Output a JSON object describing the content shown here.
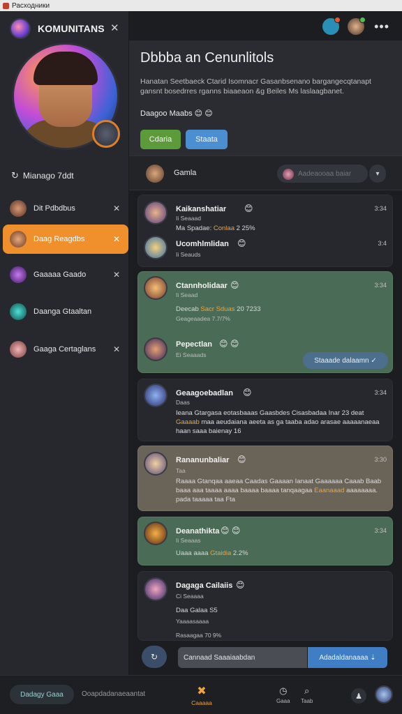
{
  "window": {
    "title": "Расходники"
  },
  "sidebar": {
    "title": "KOMUNITANS",
    "section_label": "Mianago 7ddt",
    "items": [
      {
        "label": "Dit Pdbdbus",
        "avatar_color": "#7a4a3a",
        "active": false
      },
      {
        "label": "Daag Reagdbs",
        "avatar_color": "#8a5a3c",
        "active": true
      },
      {
        "label": "Gaaaaa Gaado",
        "avatar_color": "#8b3bd0",
        "active": false
      },
      {
        "label": "Daanga Gtaaltan",
        "avatar_color": "#1aa8a0",
        "active": false
      },
      {
        "label": "Gaaga Certaglans",
        "avatar_color": "#d08a8a",
        "active": false
      }
    ]
  },
  "main": {
    "title": "Dbbba an Cenunlitols",
    "description": "Hanatan Seetbaeck Ctarid Isomnacr Gasanbsenano bargangecqtanapt gansnt bosedrres rganns biaaeaon &g Beiles Ms laslaagbanet.",
    "status": "Daagoo Maabs",
    "buttons": {
      "primary": "Cdaria",
      "secondary": "Staata"
    }
  },
  "channel": {
    "name": "Gamla",
    "search_placeholder": "Aadeaooaa baiar"
  },
  "messages": [
    {
      "name": "Kaikanshatiar",
      "time": "3:34",
      "sub": "Ii Seaaad",
      "line_pre": "Ma Spadae:",
      "line_hl": "Conlaa",
      "line_post": "2 25%"
    },
    {
      "name": "Ucomhlmlidan",
      "time": "3:4",
      "sub": "Ii Seauds"
    },
    {
      "name": "Ctannholidaar",
      "time": "3:34",
      "sub": "Ii Seaad",
      "line_pre": "Deecab",
      "line_hl": "Sacr Sduas",
      "line_post": "20 7233",
      "extra": "Geageaadea 7.7/7%"
    },
    {
      "name": "Pepectlan",
      "time": "",
      "sub": "Ei Seaaads",
      "action": "Staaade dalaamn"
    },
    {
      "name": "Geaagoebadlan",
      "time": "3:34",
      "sub": "Daas",
      "body_pre": "Ieana Gtargasa eotasbaaas Gaasbdes Cisasbadaa Inar 23 deat",
      "body_hl": "Gaaaab",
      "body_post": "maa aeudaiana aeeta as ga taaba adao arasae aaaaanaeaa haan saaa baienay 16"
    },
    {
      "name": "Rananunbaliar",
      "time": "3:30",
      "sub": "Taa",
      "body_pre": "Raaaa Gtanqaa aaeaa Caadas Gaaaan Ianaat Gaaaaaa Caaab Baab baaa aaa taaaa aaaa baaaa baaaa tanqaagaa",
      "body_hl": "Eaanaaad",
      "body_post": "aaaaaaaa. pada taaaaa taa Fta"
    },
    {
      "name": "Deanathikta",
      "time": "3:34",
      "sub": "Ii Seaaas",
      "line_pre": "Uaaa aaaa",
      "line_hl": "Gtaidia",
      "line_post": "2.2%"
    },
    {
      "name": "Dagaga Cailaiis",
      "time": "",
      "sub": "Ci Seaaaa",
      "line_pre": "Daa Galaa",
      "line_hl": "",
      "line_post": "S5",
      "extra": "Yaaaasaaaa",
      "extra2": "Rasaagaa 70 9%"
    }
  ],
  "composer": {
    "input_value": "Cannaad Saaaiaabdan",
    "send_label": "Adadaldanaaaa"
  },
  "bottom_bar": {
    "pill_label": "Dadagy Gaaa",
    "text": "Ooapdadanaeaantat",
    "center_label": "Caaaaa",
    "icon1_label": "Gaaa",
    "icon2_label": "Taab"
  }
}
